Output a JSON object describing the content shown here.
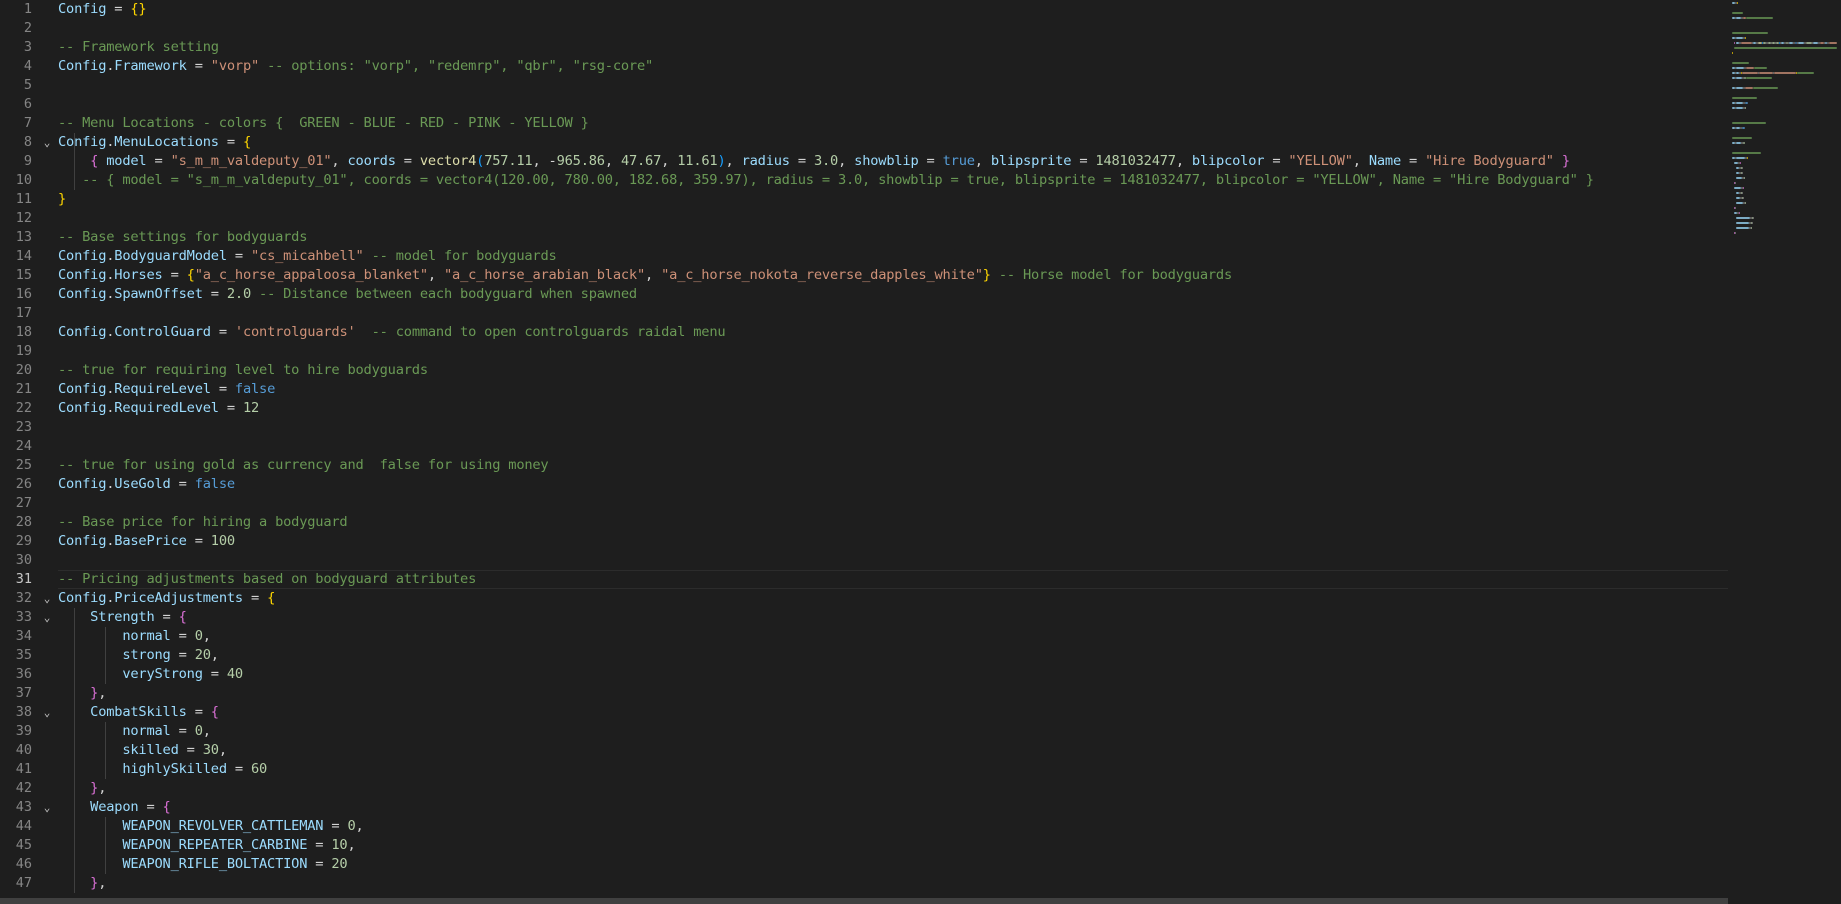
{
  "editor": {
    "language": "lua",
    "active_line": 31,
    "lines": [
      {
        "n": "1",
        "fold": false,
        "tokens": [
          [
            "var",
            "Config"
          ],
          [
            "op",
            " = "
          ],
          [
            "b1",
            "{}"
          ]
        ]
      },
      {
        "n": "2",
        "fold": false,
        "tokens": []
      },
      {
        "n": "3",
        "fold": false,
        "tokens": [
          [
            "c",
            "-- Framework setting"
          ]
        ]
      },
      {
        "n": "4",
        "fold": false,
        "tokens": [
          [
            "var",
            "Config"
          ],
          [
            "op",
            "."
          ],
          [
            "var",
            "Framework"
          ],
          [
            "op",
            " = "
          ],
          [
            "s",
            "\"vorp\""
          ],
          [
            "c",
            " -- options: \"vorp\", \"redemrp\", \"qbr\", \"rsg-core\""
          ]
        ]
      },
      {
        "n": "5",
        "fold": false,
        "tokens": []
      },
      {
        "n": "6",
        "fold": false,
        "tokens": []
      },
      {
        "n": "7",
        "fold": false,
        "tokens": [
          [
            "c",
            "-- Menu Locations - colors {  GREEN - BLUE - RED - PINK - YELLOW }"
          ]
        ]
      },
      {
        "n": "8",
        "fold": true,
        "tokens": [
          [
            "var",
            "Config"
          ],
          [
            "op",
            "."
          ],
          [
            "var",
            "MenuLocations"
          ],
          [
            "op",
            " = "
          ],
          [
            "b1",
            "{"
          ]
        ]
      },
      {
        "n": "9",
        "fold": false,
        "tokens": [
          [
            "op",
            "    "
          ],
          [
            "b2",
            "{"
          ],
          [
            "op",
            " "
          ],
          [
            "var",
            "model"
          ],
          [
            "op",
            " = "
          ],
          [
            "s",
            "\"s_m_m_valdeputy_01\""
          ],
          [
            "op",
            ", "
          ],
          [
            "var",
            "coords"
          ],
          [
            "op",
            " = "
          ],
          [
            "f",
            "vector4"
          ],
          [
            "b3",
            "("
          ],
          [
            "n",
            "757.11"
          ],
          [
            "op",
            ", -"
          ],
          [
            "n",
            "965.86"
          ],
          [
            "op",
            ", "
          ],
          [
            "n",
            "47.67"
          ],
          [
            "op",
            ", "
          ],
          [
            "n",
            "11.61"
          ],
          [
            "b3",
            ")"
          ],
          [
            "op",
            ", "
          ],
          [
            "var",
            "radius"
          ],
          [
            "op",
            " = "
          ],
          [
            "n",
            "3.0"
          ],
          [
            "op",
            ", "
          ],
          [
            "var",
            "showblip"
          ],
          [
            "op",
            " = "
          ],
          [
            "k",
            "true"
          ],
          [
            "op",
            ", "
          ],
          [
            "var",
            "blipsprite"
          ],
          [
            "op",
            " = "
          ],
          [
            "n",
            "1481032477"
          ],
          [
            "op",
            ", "
          ],
          [
            "var",
            "blipcolor"
          ],
          [
            "op",
            " = "
          ],
          [
            "s",
            "\"YELLOW\""
          ],
          [
            "op",
            ", "
          ],
          [
            "var",
            "Name"
          ],
          [
            "op",
            " = "
          ],
          [
            "s",
            "\"Hire Bodyguard\""
          ],
          [
            "op",
            " "
          ],
          [
            "b2",
            "}"
          ]
        ]
      },
      {
        "n": "10",
        "fold": false,
        "tokens": [
          [
            "op",
            "   "
          ],
          [
            "c",
            "-- { model = \"s_m_m_valdeputy_01\", coords = vector4(120.00, 780.00, 182.68, 359.97), radius = 3.0, showblip = true, blipsprite = 1481032477, blipcolor = \"YELLOW\", Name = \"Hire Bodyguard\" }"
          ]
        ]
      },
      {
        "n": "11",
        "fold": false,
        "tokens": [
          [
            "b1",
            "}"
          ]
        ]
      },
      {
        "n": "12",
        "fold": false,
        "tokens": []
      },
      {
        "n": "13",
        "fold": false,
        "tokens": [
          [
            "c",
            "-- Base settings for bodyguards"
          ]
        ]
      },
      {
        "n": "14",
        "fold": false,
        "tokens": [
          [
            "var",
            "Config"
          ],
          [
            "op",
            "."
          ],
          [
            "var",
            "BodyguardModel"
          ],
          [
            "op",
            " = "
          ],
          [
            "s",
            "\"cs_micahbell\""
          ],
          [
            "c",
            " -- model for bodyguards"
          ]
        ]
      },
      {
        "n": "15",
        "fold": false,
        "tokens": [
          [
            "var",
            "Config"
          ],
          [
            "op",
            "."
          ],
          [
            "var",
            "Horses"
          ],
          [
            "op",
            " = "
          ],
          [
            "b1",
            "{"
          ],
          [
            "s",
            "\"a_c_horse_appaloosa_blanket\""
          ],
          [
            "op",
            ", "
          ],
          [
            "s",
            "\"a_c_horse_arabian_black\""
          ],
          [
            "op",
            ", "
          ],
          [
            "s",
            "\"a_c_horse_nokota_reverse_dapples_white\""
          ],
          [
            "b1",
            "}"
          ],
          [
            "c",
            " -- Horse model for bodyguards"
          ]
        ]
      },
      {
        "n": "16",
        "fold": false,
        "tokens": [
          [
            "var",
            "Config"
          ],
          [
            "op",
            "."
          ],
          [
            "var",
            "SpawnOffset"
          ],
          [
            "op",
            " = "
          ],
          [
            "n",
            "2.0"
          ],
          [
            "c",
            " -- Distance between each bodyguard when spawned"
          ]
        ]
      },
      {
        "n": "17",
        "fold": false,
        "tokens": []
      },
      {
        "n": "18",
        "fold": false,
        "tokens": [
          [
            "var",
            "Config"
          ],
          [
            "op",
            "."
          ],
          [
            "var",
            "ControlGuard"
          ],
          [
            "op",
            " = "
          ],
          [
            "s",
            "'controlguards'"
          ],
          [
            "c",
            "  -- command to open controlguards raidal menu"
          ]
        ]
      },
      {
        "n": "19",
        "fold": false,
        "tokens": []
      },
      {
        "n": "20",
        "fold": false,
        "tokens": [
          [
            "c",
            "-- true for requiring level to hire bodyguards"
          ]
        ]
      },
      {
        "n": "21",
        "fold": false,
        "tokens": [
          [
            "var",
            "Config"
          ],
          [
            "op",
            "."
          ],
          [
            "var",
            "RequireLevel"
          ],
          [
            "op",
            " = "
          ],
          [
            "k",
            "false"
          ]
        ]
      },
      {
        "n": "22",
        "fold": false,
        "tokens": [
          [
            "var",
            "Config"
          ],
          [
            "op",
            "."
          ],
          [
            "var",
            "RequiredLevel"
          ],
          [
            "op",
            " = "
          ],
          [
            "n",
            "12"
          ]
        ]
      },
      {
        "n": "23",
        "fold": false,
        "tokens": []
      },
      {
        "n": "24",
        "fold": false,
        "tokens": []
      },
      {
        "n": "25",
        "fold": false,
        "tokens": [
          [
            "c",
            "-- true for using gold as currency and  false for using money"
          ]
        ]
      },
      {
        "n": "26",
        "fold": false,
        "tokens": [
          [
            "var",
            "Config"
          ],
          [
            "op",
            "."
          ],
          [
            "var",
            "UseGold"
          ],
          [
            "op",
            " = "
          ],
          [
            "k",
            "false"
          ]
        ]
      },
      {
        "n": "27",
        "fold": false,
        "tokens": []
      },
      {
        "n": "28",
        "fold": false,
        "tokens": [
          [
            "c",
            "-- Base price for hiring a bodyguard"
          ]
        ]
      },
      {
        "n": "29",
        "fold": false,
        "tokens": [
          [
            "var",
            "Config"
          ],
          [
            "op",
            "."
          ],
          [
            "var",
            "BasePrice"
          ],
          [
            "op",
            " = "
          ],
          [
            "n",
            "100"
          ]
        ]
      },
      {
        "n": "30",
        "fold": false,
        "tokens": []
      },
      {
        "n": "31",
        "fold": false,
        "tokens": [
          [
            "c",
            "-- Pricing adjustments based on bodyguard attributes"
          ]
        ]
      },
      {
        "n": "32",
        "fold": true,
        "tokens": [
          [
            "var",
            "Config"
          ],
          [
            "op",
            "."
          ],
          [
            "var",
            "PriceAdjustments"
          ],
          [
            "op",
            " = "
          ],
          [
            "b1",
            "{"
          ]
        ]
      },
      {
        "n": "33",
        "fold": true,
        "tokens": [
          [
            "op",
            "    "
          ],
          [
            "var",
            "Strength"
          ],
          [
            "op",
            " = "
          ],
          [
            "b2",
            "{"
          ]
        ]
      },
      {
        "n": "34",
        "fold": false,
        "tokens": [
          [
            "op",
            "        "
          ],
          [
            "var",
            "normal"
          ],
          [
            "op",
            " = "
          ],
          [
            "n",
            "0"
          ],
          [
            "op",
            ","
          ]
        ]
      },
      {
        "n": "35",
        "fold": false,
        "tokens": [
          [
            "op",
            "        "
          ],
          [
            "var",
            "strong"
          ],
          [
            "op",
            " = "
          ],
          [
            "n",
            "20"
          ],
          [
            "op",
            ","
          ]
        ]
      },
      {
        "n": "36",
        "fold": false,
        "tokens": [
          [
            "op",
            "        "
          ],
          [
            "var",
            "veryStrong"
          ],
          [
            "op",
            " = "
          ],
          [
            "n",
            "40"
          ]
        ]
      },
      {
        "n": "37",
        "fold": false,
        "tokens": [
          [
            "op",
            "    "
          ],
          [
            "b2",
            "}"
          ],
          [
            "op",
            ","
          ]
        ]
      },
      {
        "n": "38",
        "fold": true,
        "tokens": [
          [
            "op",
            "    "
          ],
          [
            "var",
            "CombatSkills"
          ],
          [
            "op",
            " = "
          ],
          [
            "b2",
            "{"
          ]
        ]
      },
      {
        "n": "39",
        "fold": false,
        "tokens": [
          [
            "op",
            "        "
          ],
          [
            "var",
            "normal"
          ],
          [
            "op",
            " = "
          ],
          [
            "n",
            "0"
          ],
          [
            "op",
            ","
          ]
        ]
      },
      {
        "n": "40",
        "fold": false,
        "tokens": [
          [
            "op",
            "        "
          ],
          [
            "var",
            "skilled"
          ],
          [
            "op",
            " = "
          ],
          [
            "n",
            "30"
          ],
          [
            "op",
            ","
          ]
        ]
      },
      {
        "n": "41",
        "fold": false,
        "tokens": [
          [
            "op",
            "        "
          ],
          [
            "var",
            "highlySkilled"
          ],
          [
            "op",
            " = "
          ],
          [
            "n",
            "60"
          ]
        ]
      },
      {
        "n": "42",
        "fold": false,
        "tokens": [
          [
            "op",
            "    "
          ],
          [
            "b2",
            "}"
          ],
          [
            "op",
            ","
          ]
        ]
      },
      {
        "n": "43",
        "fold": true,
        "tokens": [
          [
            "op",
            "    "
          ],
          [
            "var",
            "Weapon"
          ],
          [
            "op",
            " = "
          ],
          [
            "b2",
            "{"
          ]
        ]
      },
      {
        "n": "44",
        "fold": false,
        "tokens": [
          [
            "op",
            "        "
          ],
          [
            "var",
            "WEAPON_REVOLVER_CATTLEMAN"
          ],
          [
            "op",
            " = "
          ],
          [
            "n",
            "0"
          ],
          [
            "op",
            ","
          ]
        ]
      },
      {
        "n": "45",
        "fold": false,
        "tokens": [
          [
            "op",
            "        "
          ],
          [
            "var",
            "WEAPON_REPEATER_CARBINE"
          ],
          [
            "op",
            " = "
          ],
          [
            "n",
            "10"
          ],
          [
            "op",
            ","
          ]
        ]
      },
      {
        "n": "46",
        "fold": false,
        "tokens": [
          [
            "op",
            "        "
          ],
          [
            "var",
            "WEAPON_RIFLE_BOLTACTION"
          ],
          [
            "op",
            " = "
          ],
          [
            "n",
            "20"
          ]
        ]
      },
      {
        "n": "47",
        "fold": false,
        "tokens": [
          [
            "op",
            "    "
          ],
          [
            "b2",
            "}"
          ],
          [
            "op",
            ","
          ]
        ]
      }
    ]
  },
  "colors": {
    "background": "#1e1e1e",
    "comment": "#6a9955",
    "string": "#ce9178",
    "number": "#b5cea8",
    "keyword": "#569cd6",
    "variable": "#9cdcfe",
    "bracket_level1": "#ffd700",
    "bracket_level2": "#da70d6",
    "bracket_level3": "#179fff"
  }
}
